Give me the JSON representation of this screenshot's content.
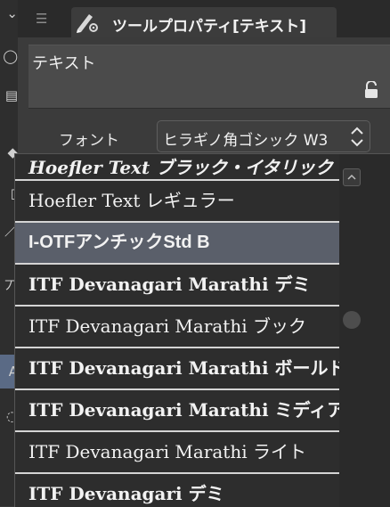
{
  "panel": {
    "title": "ツールプロパティ[テキスト]",
    "preview_text": "テキスト"
  },
  "font_setting": {
    "label": "フォント",
    "selected_value": "ヒラギノ角ゴシック W3"
  },
  "font_list": {
    "items": [
      {
        "label": "Hoefler Text ブラック・イタリック"
      },
      {
        "label": "Hoefler Text レギュラー"
      },
      {
        "label": "I-OTFアンチックStd B"
      },
      {
        "label": "ITF Devanagari Marathi デミ"
      },
      {
        "label": "ITF Devanagari Marathi ブック"
      },
      {
        "label": "ITF Devanagari Marathi ボールド"
      },
      {
        "label": "ITF Devanagari Marathi ミディアム"
      },
      {
        "label": "ITF Devanagari Marathi ライト"
      },
      {
        "label": "ITF Devanagari デミ"
      }
    ]
  },
  "toolstrip": {
    "icons": [
      "expand-icon",
      "lasso-icon",
      "layers-icon",
      "fill-icon",
      "ruler-icon",
      "brush-icon",
      "text-icon",
      "eraser-icon",
      "hand-icon"
    ]
  },
  "colors": {
    "panel_bg": "#3b3b3b",
    "title_bar": "#2a2a2a",
    "dropdown_bg": "#2d2d2d",
    "selected_row": "#5a5f6a",
    "active_tool": "#5a6a85"
  }
}
